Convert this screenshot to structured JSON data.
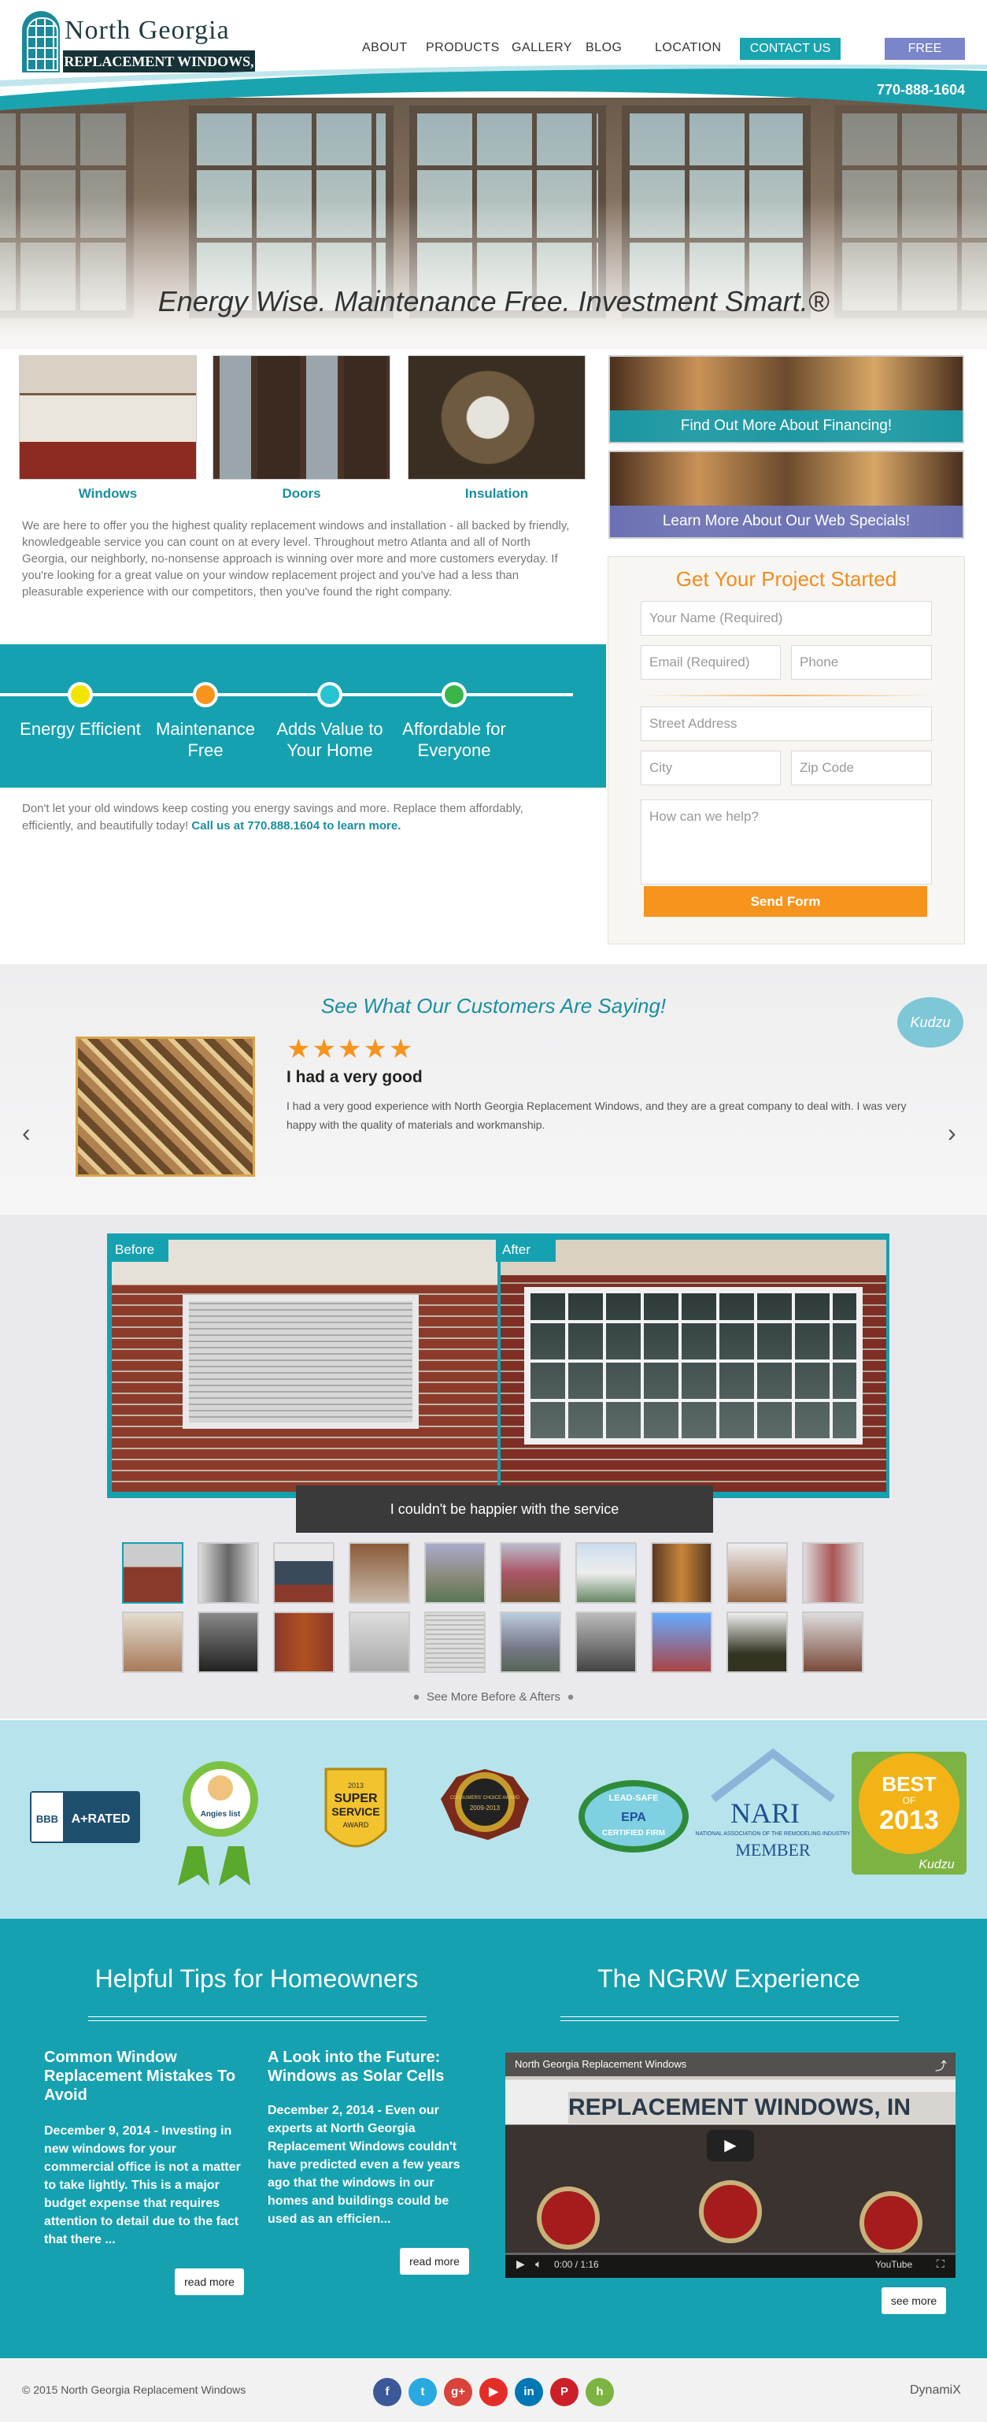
{
  "header": {
    "logo_line1": "North Georgia",
    "logo_line2": "REPLACEMENT WINDOWS, INC.",
    "nav": [
      "ABOUT",
      "PRODUCTS",
      "GALLERY",
      "BLOG",
      "LOCATION"
    ],
    "contact_label": "CONTACT US",
    "proposal_label": "FREE PROPOSAL",
    "phone": "770-888-1604"
  },
  "hero": {
    "tagline": "Energy Wise. Maintenance Free. Investment Smart.®"
  },
  "products": [
    {
      "label": "Windows"
    },
    {
      "label": "Doors"
    },
    {
      "label": "Insulation"
    }
  ],
  "about": "We are here to offer you the highest quality replacement windows and installation - all backed by friendly, knowledgeable service you can count on at every level. Throughout metro Atlanta and all of North Georgia, our neighborly, no-nonsense approach is winning over more and more customers everyday. If you're looking for a great value on your window replacement project and you've had a less than pleasurable experience with our competitors, then you've found the right company.",
  "benefits": [
    {
      "label": "Energy Efficient",
      "color": "#f2e600"
    },
    {
      "label": "Maintenance Free",
      "color": "#f7941d"
    },
    {
      "label": "Adds Value to Your Home",
      "color": "#27c3d3"
    },
    {
      "label": "Affordable for Everyone",
      "color": "#39b54a"
    }
  ],
  "cta": {
    "text": "Don't let your old windows keep costing you energy savings and more. Replace them affordably, efficiently, and beautifully today! ",
    "link": "Call us at 770.888.1604 to learn more."
  },
  "promos": {
    "financing": "Find Out More About Financing!",
    "specials": "Learn More About Our Web Specials!"
  },
  "form": {
    "title": "Get Your Project Started",
    "name_placeholder": "Your Name (Required)",
    "email_placeholder": "Email (Required)",
    "phone_placeholder": "Phone",
    "street_placeholder": "Street Address",
    "city_placeholder": "City",
    "zip_placeholder": "Zip Code",
    "message_placeholder": "How can we help?",
    "submit_label": "Send Form"
  },
  "testimonials": {
    "title": "See What Our Customers Are Saying!",
    "kudzu": "Kudzu",
    "stars": "★★★★★",
    "rating": 5,
    "review_title": "I had a very good",
    "review_text": "I had a very good experience with North Georgia Replacement Windows, and they are a great company to deal with. I was very happy with the quality of materials and workmanship.",
    "prev": "‹",
    "next": "›"
  },
  "before_after": {
    "before_label": "Before",
    "after_label": "After",
    "caption": "I couldn't be happier with the service",
    "see_more": "See More Before & Afters"
  },
  "badges": {
    "bbb_rating": "A+RATED",
    "bbb": "BBB",
    "angies": "Angies list",
    "super_service_1": "SUPER",
    "super_service_2": "SERVICE",
    "super_service_3": "AWARD",
    "super_service_year": "2013",
    "consumers_choice": "CONSUMERS' CHOICE AWARD",
    "consumers_years": "2009-2013",
    "epa_1": "LEAD-SAFE",
    "epa_2": "EPA",
    "epa_3": "CERTIFIED FIRM",
    "nari_1": "NARI",
    "nari_2": "NATIONAL ASSOCIATION OF THE REMODELING INDUSTRY",
    "nari_3": "MEMBER",
    "best_1": "BEST",
    "best_2": "OF",
    "best_3": "2013",
    "best_kudzu": "Kudzu"
  },
  "tips": {
    "title": "Helpful Tips for Homeowners",
    "posts": [
      {
        "title": "Common Window Replacement Mistakes To Avoid",
        "text": "December 9, 2014 - Investing in new windows for your commercial office is not a matter to take lightly. This is a major budget expense that requires attention to detail due to the fact that there ...",
        "button": "read more"
      },
      {
        "title": "A Look into the Future: Windows as Solar Cells",
        "text": "December 2, 2014 - Even our experts at North Georgia Replacement Windows couldn't have predicted even a few years ago that the windows in our homes and buildings could be used as an efficien...",
        "button": "read more"
      }
    ]
  },
  "experience": {
    "title": "The NGRW Experience",
    "video_title": "North Georgia Replacement Windows",
    "video_sign": "REPLACEMENT WINDOWS, IN",
    "video_time": "0:00 / 1:16",
    "see_more": "see more"
  },
  "footer": {
    "copyright": "© 2015 North Georgia Replacement Windows",
    "social": [
      {
        "icon": "f",
        "color": "#3b5998",
        "name": "facebook"
      },
      {
        "icon": "t",
        "color": "#2aa9e0",
        "name": "twitter"
      },
      {
        "icon": "g+",
        "color": "#d8433a",
        "name": "google-plus"
      },
      {
        "icon": "▶",
        "color": "#e52d27",
        "name": "youtube"
      },
      {
        "icon": "in",
        "color": "#0077b5",
        "name": "linkedin"
      },
      {
        "icon": "P",
        "color": "#cb2027",
        "name": "pinterest"
      },
      {
        "icon": "h",
        "color": "#7cb342",
        "name": "houzz"
      }
    ],
    "credit": "DynamiX"
  }
}
